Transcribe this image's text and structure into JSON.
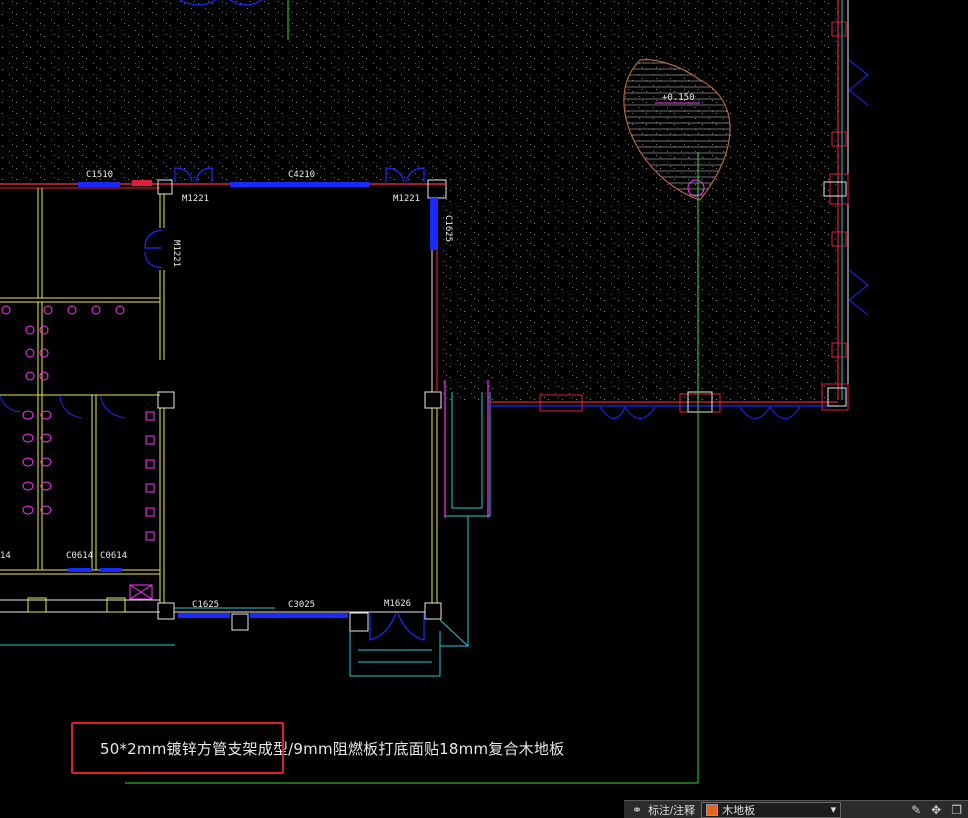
{
  "labels": {
    "c1510": "C1510",
    "c4210": "C4210",
    "m1221_a": "M1221",
    "m1221_b": "M1221",
    "m1221_c": "M1221",
    "c1625_v": "C1625",
    "c1625_h": "C1625",
    "c3025": "C3025",
    "m1626": "M1626",
    "c0614_a": "C0614",
    "c0614_b": "C0614",
    "c0614_c": "14",
    "elevation": "+0.150"
  },
  "note": {
    "text": "50*2mm镀锌方管支架成型/9mm阻燃板打底面贴18mm复合木地板"
  },
  "statusbar": {
    "snap_icon": "snap-icon",
    "annotation_scale": "标注/注释",
    "layer_value": "木地板",
    "layer_color": "#e8641a"
  },
  "colors": {
    "wall_red": "#e0203a",
    "wall_yellow": "#e8e84a",
    "door_blue": "#1a2aff",
    "window_cyan": "#22c8d8",
    "magenta": "#ff33ff",
    "green": "#33dd33",
    "hatch_brown": "#b4643c"
  }
}
